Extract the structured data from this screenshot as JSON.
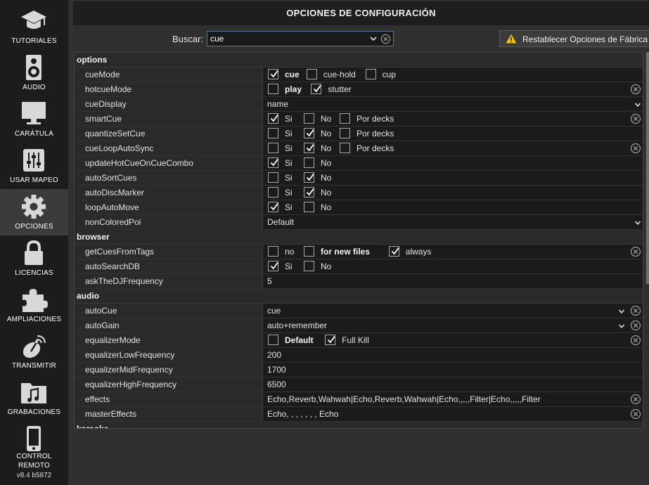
{
  "sidebar": {
    "items": [
      {
        "label": "TUTORIALES",
        "icon": "graduation-cap-icon"
      },
      {
        "label": "AUDIO",
        "icon": "speaker-icon"
      },
      {
        "label": "CARÁTULA",
        "icon": "monitor-icon"
      },
      {
        "label": "USAR MAPEO",
        "icon": "sliders-icon"
      },
      {
        "label": "OPCIONES",
        "icon": "gear-icon"
      },
      {
        "label": "LICENCIAS",
        "icon": "lock-icon"
      },
      {
        "label": "AMPLIACIONES",
        "icon": "puzzle-icon"
      },
      {
        "label": "TRANSMITIR",
        "icon": "broadcast-icon"
      },
      {
        "label": "GRABACIONES",
        "icon": "music-folder-icon"
      },
      {
        "label": "CONTROL\nREMOTO",
        "icon": "phone-icon"
      }
    ],
    "active": "OPCIONES",
    "version": "v8.4 b5872"
  },
  "header": {
    "title": "OPCIONES DE CONFIGURACIÓN"
  },
  "search": {
    "label": "Buscar:",
    "value": "cue"
  },
  "reset_button": {
    "label": "Restablecer Opciones de Fábrica"
  },
  "colors": {
    "accent_check": "#ffffff",
    "warning": "#f5c400",
    "sidebar_bg": "#1c1c1c"
  },
  "sections": [
    {
      "title": "options",
      "rows": [
        {
          "name": "cueMode",
          "type": "checks",
          "options": [
            {
              "label": "cue",
              "checked": true,
              "bold": true
            },
            {
              "label": "cue-hold",
              "checked": false
            },
            {
              "label": "cup",
              "checked": false
            }
          ],
          "clear": false
        },
        {
          "name": "hotcueMode",
          "type": "checks",
          "options": [
            {
              "label": "play",
              "checked": false,
              "bold": true
            },
            {
              "label": "stutter",
              "checked": true
            }
          ],
          "clear": true
        },
        {
          "name": "cueDisplay",
          "type": "dropdown",
          "value": "name",
          "clear": false
        },
        {
          "name": "smartCue",
          "type": "checks",
          "options": [
            {
              "label": "Si",
              "checked": true
            },
            {
              "label": "No",
              "checked": false
            },
            {
              "label": "Por decks",
              "checked": false
            }
          ],
          "clear": true
        },
        {
          "name": "quantizeSetCue",
          "type": "checks",
          "options": [
            {
              "label": "Si",
              "checked": false
            },
            {
              "label": "No",
              "checked": true
            },
            {
              "label": "Por decks",
              "checked": false
            }
          ],
          "clear": false
        },
        {
          "name": "cueLoopAutoSync",
          "type": "checks",
          "options": [
            {
              "label": "Si",
              "checked": false
            },
            {
              "label": "No",
              "checked": true
            },
            {
              "label": "Por decks",
              "checked": false
            }
          ],
          "clear": true
        },
        {
          "name": "updateHotCueOnCueCombo",
          "type": "checks",
          "options": [
            {
              "label": "Si",
              "checked": true
            },
            {
              "label": "No",
              "checked": false
            }
          ],
          "clear": false
        },
        {
          "name": "autoSortCues",
          "type": "checks",
          "options": [
            {
              "label": "Si",
              "checked": false
            },
            {
              "label": "No",
              "checked": true
            }
          ],
          "clear": false
        },
        {
          "name": "autoDiscMarker",
          "type": "checks",
          "options": [
            {
              "label": "Si",
              "checked": false
            },
            {
              "label": "No",
              "checked": true
            }
          ],
          "clear": false
        },
        {
          "name": "loopAutoMove",
          "type": "checks",
          "options": [
            {
              "label": "Si",
              "checked": true
            },
            {
              "label": "No",
              "checked": false
            }
          ],
          "clear": false
        },
        {
          "name": "nonColoredPoi",
          "type": "dropdown",
          "value": "Default",
          "clear": false
        }
      ]
    },
    {
      "title": "browser",
      "rows": [
        {
          "name": "getCuesFromTags",
          "type": "checks",
          "options": [
            {
              "label": "no",
              "checked": false
            },
            {
              "label": "for new files",
              "checked": false,
              "bold": true
            },
            {
              "label": "always",
              "checked": true
            }
          ],
          "clear": true
        },
        {
          "name": "autoSearchDB",
          "type": "checks",
          "options": [
            {
              "label": "Si",
              "checked": true
            },
            {
              "label": "No",
              "checked": false
            }
          ],
          "clear": false
        },
        {
          "name": "askTheDJFrequency",
          "type": "text",
          "value": "5",
          "clear": false
        }
      ]
    },
    {
      "title": "audio",
      "rows": [
        {
          "name": "autoCue",
          "type": "dropdown",
          "value": "cue",
          "clear": true
        },
        {
          "name": "autoGain",
          "type": "dropdown",
          "value": "auto+remember",
          "clear": true
        },
        {
          "name": "equalizerMode",
          "type": "checks",
          "options": [
            {
              "label": "Default",
              "checked": false,
              "bold": true
            },
            {
              "label": "Full Kill",
              "checked": true
            }
          ],
          "clear": true
        },
        {
          "name": "equalizerLowFrequency",
          "type": "text",
          "value": "200",
          "clear": false
        },
        {
          "name": "equalizerMidFrequency",
          "type": "text",
          "value": "1700",
          "clear": false
        },
        {
          "name": "equalizerHighFrequency",
          "type": "text",
          "value": "6500",
          "clear": false
        },
        {
          "name": "effects",
          "type": "text",
          "value": "Echo,Reverb,Wahwah|Echo,Reverb,Wahwah|Echo,,,,,Filter|Echo,,,,,Filter",
          "clear": true
        },
        {
          "name": "masterEffects",
          "type": "text",
          "value": "Echo, , , , , , , Echo",
          "clear": true
        }
      ]
    },
    {
      "title": "karaoke",
      "rows": []
    }
  ]
}
